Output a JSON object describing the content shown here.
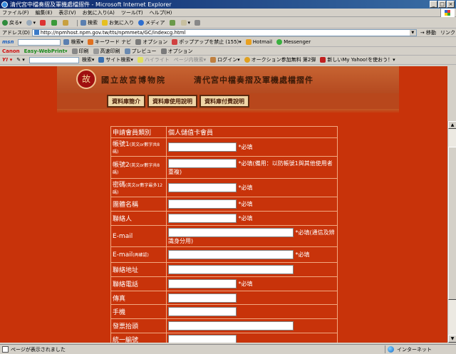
{
  "window": {
    "title": "清代宮中檔奏摺及軍機處檔摺件 - Microsoft Internet Explorer"
  },
  "menubar": [
    "ファイル(F)",
    "編集(E)",
    "表示(V)",
    "お気に入り(A)",
    "ツール(T)",
    "ヘルプ(H)"
  ],
  "toolbar_std": {
    "back": "戻る",
    "search": "検索",
    "favorites": "お気に入り",
    "media": "メディア"
  },
  "address": {
    "label": "アドレス(D)",
    "url": "http://npmhost.npm.gov.tw/tts/npmmeta/GC/indexcg.html",
    "go": "移動",
    "links": "リンク"
  },
  "toolbar_msn": {
    "brand": "msn",
    "search": "検索",
    "keyword": "キーワード ナビ",
    "options": "オプション",
    "popup": "ポップアップを禁止 (155)",
    "hotmail": "Hotmail",
    "messenger": "Messenger"
  },
  "toolbar_canon": {
    "brand": "Canon",
    "easy": "Easy-WebPrint",
    "print": "印刷",
    "hq": "高速印刷",
    "preview": "プレビュー",
    "options": "オプション"
  },
  "toolbar_yahoo": {
    "search": "検索",
    "site_search": "サイト検索",
    "highlight": "ハイライト",
    "page_search": "ページ内検索",
    "login": "ログイン",
    "auction": "オークション参加無料 第2弾",
    "myyahoo": "新しいMy Yahoo!を使おう！"
  },
  "banner": {
    "logo": "故",
    "museum": "國立故宮博物院",
    "db_title": "清代宮中檔奏摺及軍機處檔摺件"
  },
  "nav": [
    "資料庫簡介",
    "資料庫使用說明",
    "資料庫付費說明"
  ],
  "form": {
    "header_label": "申請會員類別",
    "header_value": "個人儲值卡會員",
    "rows": [
      {
        "label": "帳號1",
        "note": "(英文or數字共8碼)",
        "req": "*必填",
        "hint": ""
      },
      {
        "label": "帳號2",
        "note": "(英文or數字共8碼)",
        "req": "*必填",
        "hint": "(備用：以防帳號1與其他使用者重複)"
      },
      {
        "label": "密碼",
        "note": "(英文or數字最多12碼)",
        "req": "*必填",
        "hint": ""
      },
      {
        "label": "團體名稱",
        "note": "",
        "req": "*必填",
        "hint": ""
      },
      {
        "label": "聯絡人",
        "note": "",
        "req": "*必填",
        "hint": ""
      },
      {
        "label": "E-mail",
        "note": "",
        "req": "*必填",
        "hint": "(通信及辨識身分用)"
      },
      {
        "label": "E-mail",
        "note": "(再確認)",
        "req": "*必填",
        "hint": ""
      },
      {
        "label": "聯絡地址",
        "note": "",
        "req": "",
        "hint": ""
      },
      {
        "label": "聯絡電話",
        "note": "",
        "req": "*必填",
        "hint": ""
      },
      {
        "label": "傳真",
        "note": "",
        "req": "",
        "hint": ""
      },
      {
        "label": "手機",
        "note": "",
        "req": "",
        "hint": ""
      },
      {
        "label": "發票抬頭",
        "note": "",
        "req": "",
        "hint": ""
      },
      {
        "label": "統一編號",
        "note": "",
        "req": "",
        "hint": ""
      }
    ]
  },
  "status": {
    "text": "ページが表示されました",
    "zone": "インターネット"
  }
}
